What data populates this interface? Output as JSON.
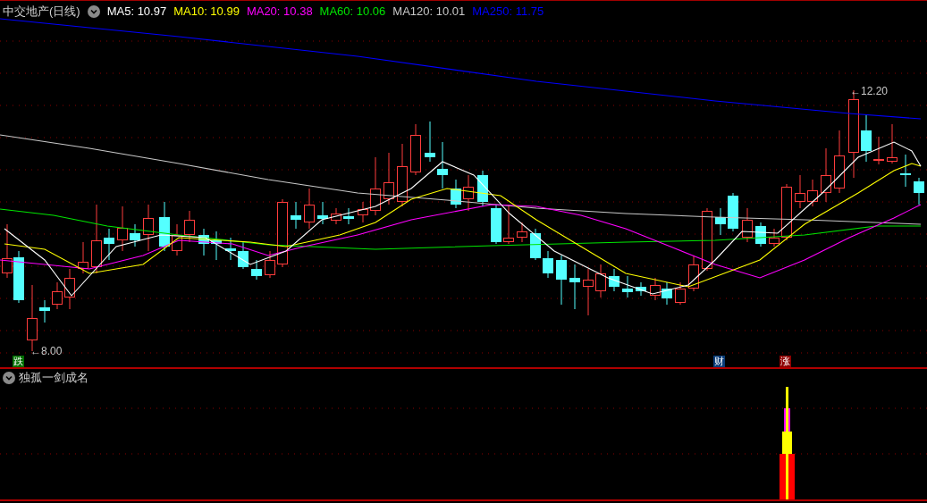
{
  "window": {
    "title": "中交地产(日线)"
  },
  "moving_averages": [
    {
      "label": "MA5: 10.97",
      "color": "#ffffff"
    },
    {
      "label": "MA10: 10.99",
      "color": "#ffff00"
    },
    {
      "label": "MA20: 10.38",
      "color": "#ff00ff"
    },
    {
      "label": "MA60: 10.06",
      "color": "#00e600"
    },
    {
      "label": "MA120: 10.01",
      "color": "#c8c8c8"
    },
    {
      "label": "MA250: 11.75",
      "color": "#0000ff"
    }
  ],
  "price_marks": [
    {
      "text": "←12.20",
      "kind": "high"
    },
    {
      "text": "←8.00",
      "kind": "low"
    }
  ],
  "event_tags": [
    {
      "text": "跌",
      "color": "#006e00"
    },
    {
      "text": "财",
      "color": "#0a3c78"
    },
    {
      "text": "涨",
      "color": "#8c0000"
    }
  ],
  "indicator": {
    "title": "独孤一剑成名"
  }
}
